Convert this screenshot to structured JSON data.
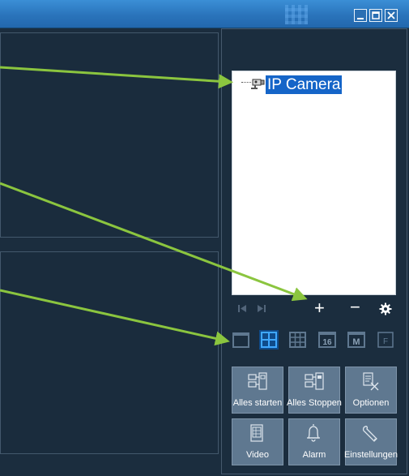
{
  "tree": {
    "root_label": "IP Camera",
    "root_icon": "camera-icon"
  },
  "controls": {
    "prev_icon": "skip-back-icon",
    "next_icon": "skip-forward-icon",
    "add_symbol": "+",
    "remove_symbol": "−",
    "settings_icon": "gear-icon"
  },
  "layout_buttons": [
    {
      "name": "layout-1",
      "icon": "single-view-icon",
      "text": ""
    },
    {
      "name": "layout-4",
      "icon": "quad-view-icon",
      "text": "",
      "active": true
    },
    {
      "name": "layout-9",
      "icon": "nine-view-icon",
      "text": ""
    },
    {
      "name": "layout-16",
      "icon": "sixteen-view-icon",
      "text": "16"
    },
    {
      "name": "layout-m",
      "icon": "m-view-icon",
      "text": "M"
    },
    {
      "name": "layout-f",
      "icon": "fullscreen-icon",
      "text": "F"
    }
  ],
  "buttons": {
    "start_all": "Alles starten",
    "stop_all": "Alles Stoppen",
    "options": "Optionen",
    "video": "Video",
    "alarm": "Alarm",
    "settings": "Einstellungen"
  },
  "colors": {
    "background": "#1b2d3e",
    "titlebar": "#2a74bb",
    "selection": "#1565c8",
    "arrow": "#8bc53f",
    "button": "#5f7890"
  }
}
